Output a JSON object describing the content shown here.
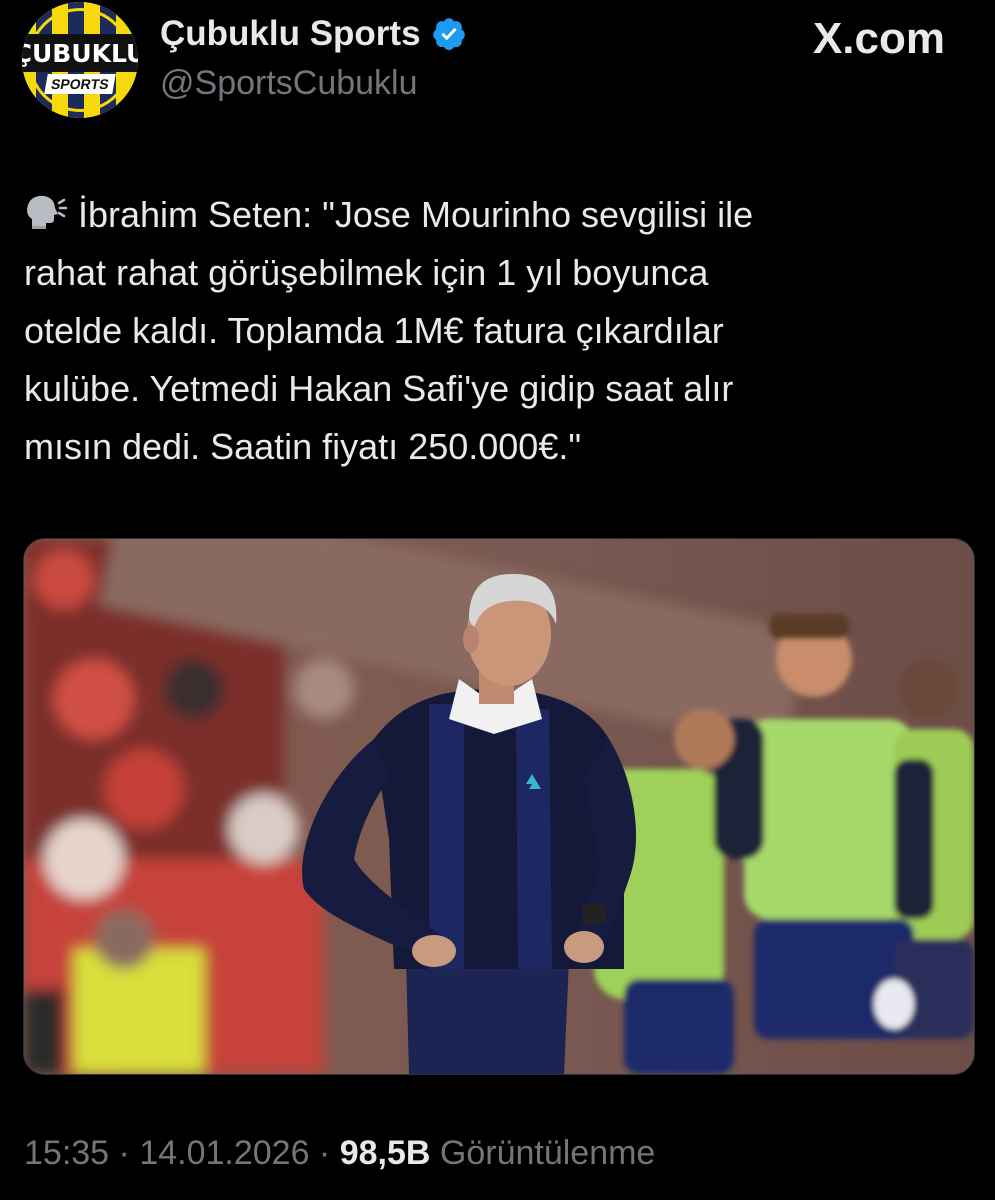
{
  "header": {
    "display_name": "Çubuklu Sports",
    "handle": "@SportsCubuklu",
    "site": "X.com",
    "avatar_text": "ÇUBUKLU",
    "avatar_subtext": "SPORTS",
    "verified_icon": "verified-badge-icon"
  },
  "tweet": {
    "lines": [
      "İbrahim Seten: \"Jose Mourinho sevgilisi ile",
      "rahat rahat görüşebilmek için 1 yıl boyunca",
      "otelde kaldı. Toplamda 1M€ fatura çıkardılar",
      "kulübe. Yetmedi Hakan Safi'ye gidip saat alır",
      "mısın dedi. Saatin fiyatı 250.000€.\""
    ],
    "emoji_icon": "speaking-head-icon"
  },
  "media": {
    "icon": "photo-coach-on-sideline"
  },
  "meta": {
    "time": "15:35",
    "sep1": " · ",
    "date": "14.01.2026",
    "sep2": " · ",
    "views": "98,5B",
    "views_label": "Görüntülenme"
  },
  "colors": {
    "background": "#000000",
    "text": "#e7e9ea",
    "muted": "#71767b",
    "verified": "#1d9bf0",
    "brand_yellow": "#f5d90a",
    "brand_navy": "#1c2a5c"
  }
}
